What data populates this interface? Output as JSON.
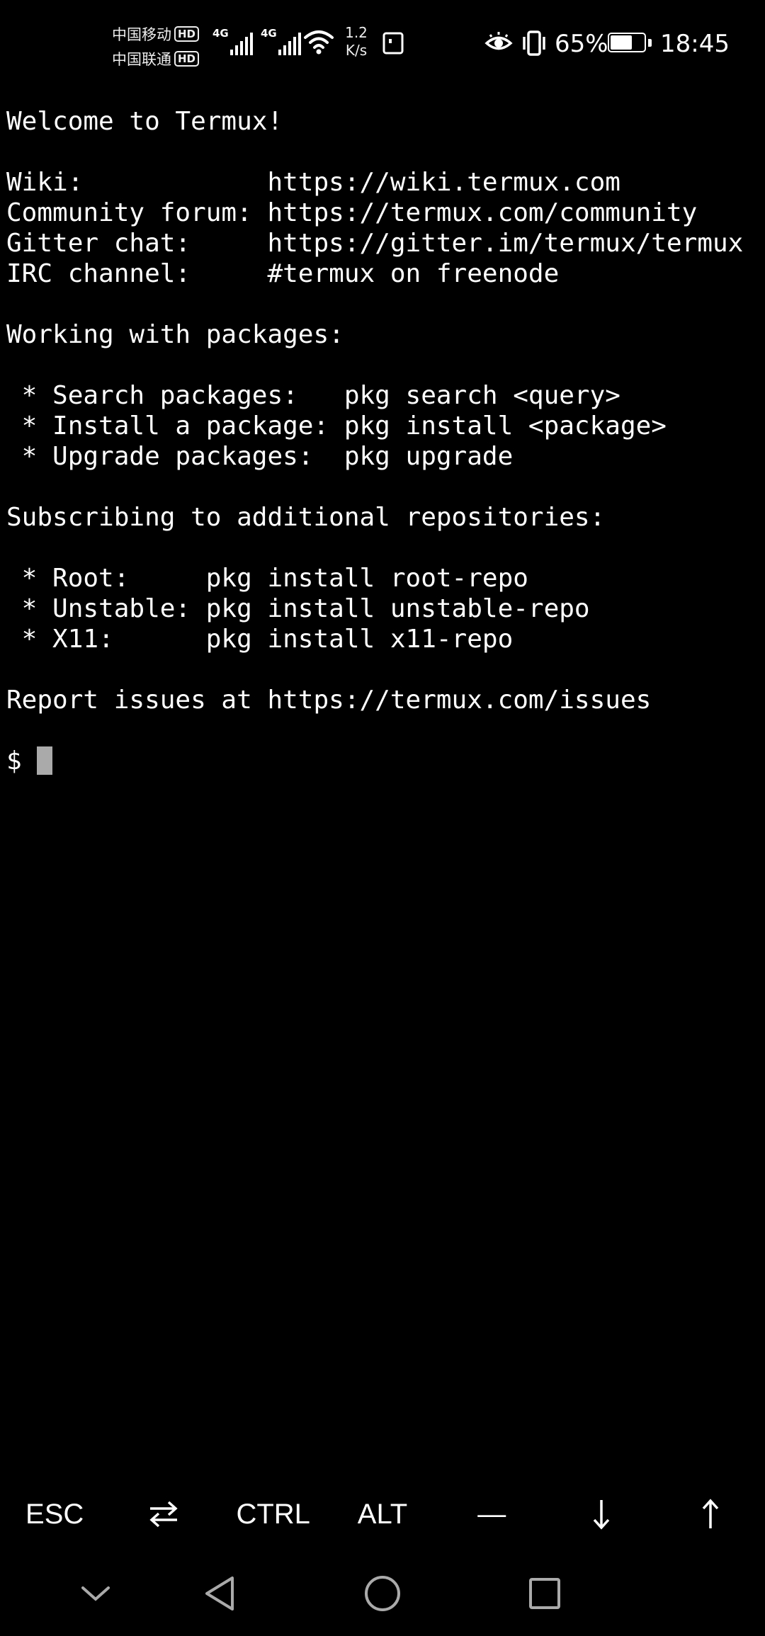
{
  "status_bar": {
    "carrier_1": "中国移动",
    "carrier_2": "中国联通",
    "hd_badge": "HD",
    "network_type": "4G",
    "net_speed_value": "1.2",
    "net_speed_unit": "K/s",
    "battery_percent": "65%",
    "battery_level": 0.65,
    "time": "18:45"
  },
  "terminal": {
    "lines": [
      "Welcome to Termux!",
      "",
      "Wiki:            https://wiki.termux.com",
      "Community forum: https://termux.com/community",
      "Gitter chat:     https://gitter.im/termux/termux",
      "IRC channel:     #termux on freenode",
      "",
      "Working with packages:",
      "",
      " * Search packages:   pkg search <query>",
      " * Install a package: pkg install <package>",
      " * Upgrade packages:  pkg upgrade",
      "",
      "Subscribing to additional repositories:",
      "",
      " * Root:     pkg install root-repo",
      " * Unstable: pkg install unstable-repo",
      " * X11:      pkg install x11-repo",
      "",
      "Report issues at https://termux.com/issues",
      ""
    ],
    "prompt": "$ "
  },
  "extra_keys": {
    "esc": "ESC",
    "tab_icon": "tab-arrows-icon",
    "ctrl": "CTRL",
    "alt": "ALT",
    "dash": "—",
    "down_icon": "arrow-down-icon",
    "up_icon": "arrow-up-icon"
  },
  "nav_bar": {
    "collapse_icon": "chevron-down-icon",
    "back_icon": "back-triangle-icon",
    "home_icon": "home-circle-icon",
    "recents_icon": "recents-square-icon"
  },
  "colors": {
    "background": "#000000",
    "foreground": "#ffffff",
    "cursor": "#aaaaaa"
  }
}
